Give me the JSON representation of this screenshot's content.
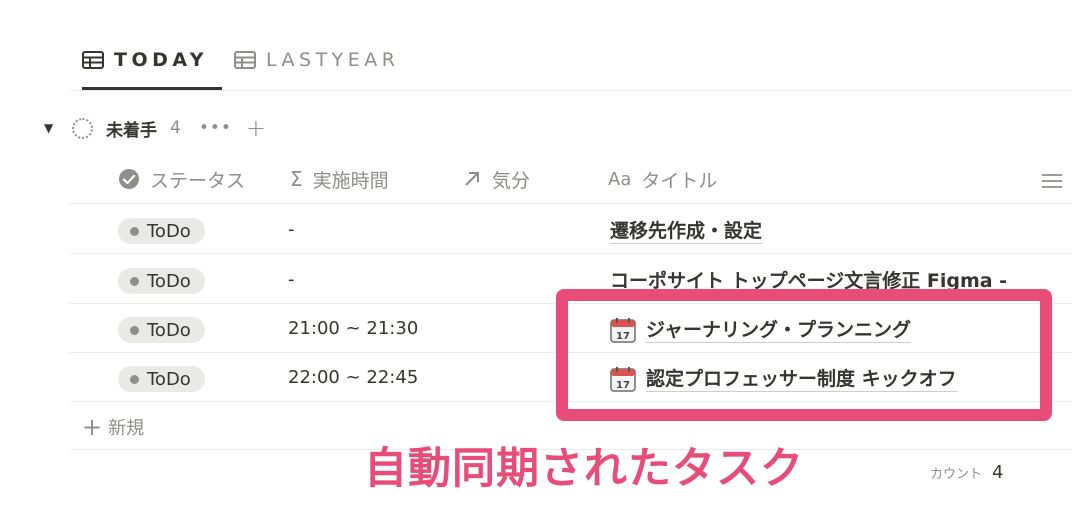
{
  "tabs": [
    {
      "label": "TODAY",
      "active": true,
      "icon": "table-icon"
    },
    {
      "label": "LASTYEAR",
      "active": false,
      "icon": "table-icon"
    }
  ],
  "group": {
    "name": "未着手",
    "count": "4",
    "more": "•••",
    "add": "+"
  },
  "columns": [
    {
      "label": "ステータス",
      "icon": "status-check-icon"
    },
    {
      "label": "実施時間",
      "icon": "sigma-icon"
    },
    {
      "label": "気分",
      "icon": "arrow-up-right-icon"
    },
    {
      "label": "タイトル",
      "icon": "text-aa-icon",
      "icon_text": "Aa"
    }
  ],
  "rows": [
    {
      "status": "ToDo",
      "time": "-",
      "title": "遷移先作成・設定",
      "calendar": false
    },
    {
      "status": "ToDo",
      "time": "-",
      "title": "コーポサイト トップページ文言修正 Figma -",
      "calendar": false
    },
    {
      "status": "ToDo",
      "time": "21:00 ~ 21:30",
      "title": "ジャーナリング・プランニング",
      "calendar": true
    },
    {
      "status": "ToDo",
      "time": "22:00 ~ 22:45",
      "title": "認定プロフェッサー制度 キックオフ",
      "calendar": true
    }
  ],
  "new_row": {
    "label": "新規",
    "plus": "+"
  },
  "footer": {
    "count_label": "カウント",
    "count_value": "4"
  },
  "annotation": {
    "text": "自動同期されたタスク",
    "color": "#e84c78"
  },
  "colors": {
    "text": "#37352f",
    "muted": "#8f8e8a",
    "badge_bg": "#e9e9e7",
    "accent": "#e84c78"
  }
}
